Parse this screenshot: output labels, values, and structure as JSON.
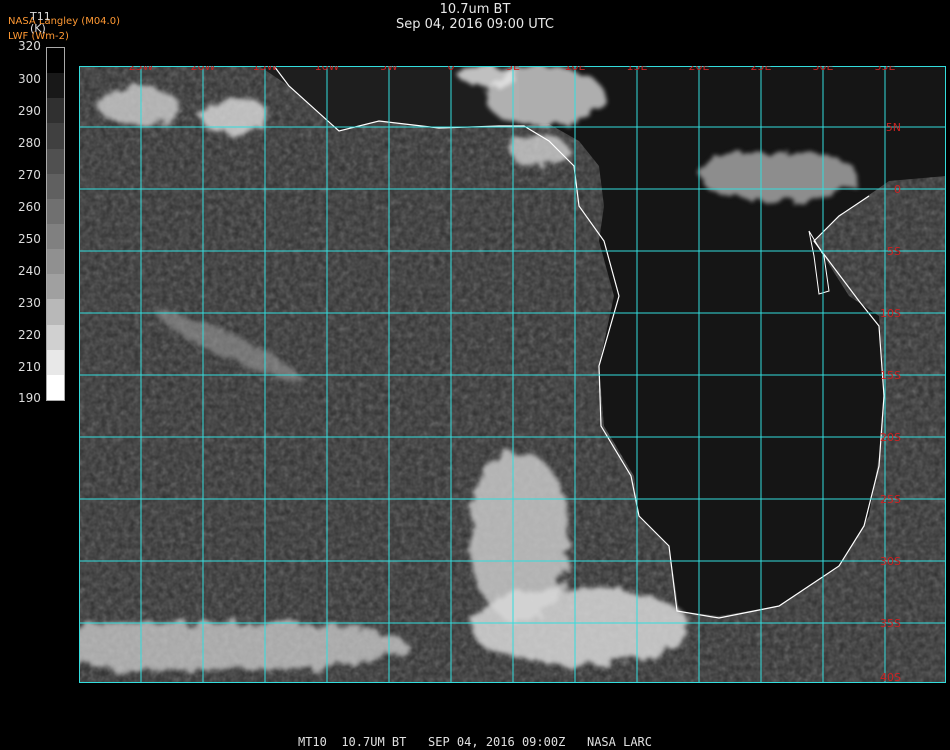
{
  "header": {
    "title": "10.7um BT",
    "datetime": "Sep 04, 2016 09:00 UTC",
    "source_line1": "NASA Langley (M04.0)",
    "source_line2": "LWF (Wm-2)"
  },
  "colorbar": {
    "label": "T11",
    "unit": "(K)",
    "ticks": [
      "320",
      "300",
      "290",
      "280",
      "270",
      "260",
      "250",
      "240",
      "230",
      "220",
      "210",
      "190"
    ],
    "colors": [
      "#000000",
      "#181818",
      "#303030",
      "#404040",
      "#505050",
      "#606060",
      "#707070",
      "#808080",
      "#909090",
      "#a0a0a0",
      "#b8b8b8",
      "#d0d0d0",
      "#e8e8e8",
      "#ffffff"
    ]
  },
  "map": {
    "grid_color": "#33dddd",
    "label_color": "#cc2222",
    "coast_color": "#ffffff",
    "lon_labels": [
      "25W",
      "20W",
      "15W",
      "10W",
      "5W",
      "0",
      "5E",
      "10E",
      "15E",
      "20E",
      "25E",
      "30E",
      "35E"
    ],
    "lat_labels": [
      "5N",
      "0",
      "5S",
      "10S",
      "15S",
      "20S",
      "25S",
      "30S",
      "35S",
      "40S"
    ]
  },
  "footer": {
    "text": "MT10  10.7UM BT   SEP 04, 2016 09:00Z   NASA LARC"
  }
}
